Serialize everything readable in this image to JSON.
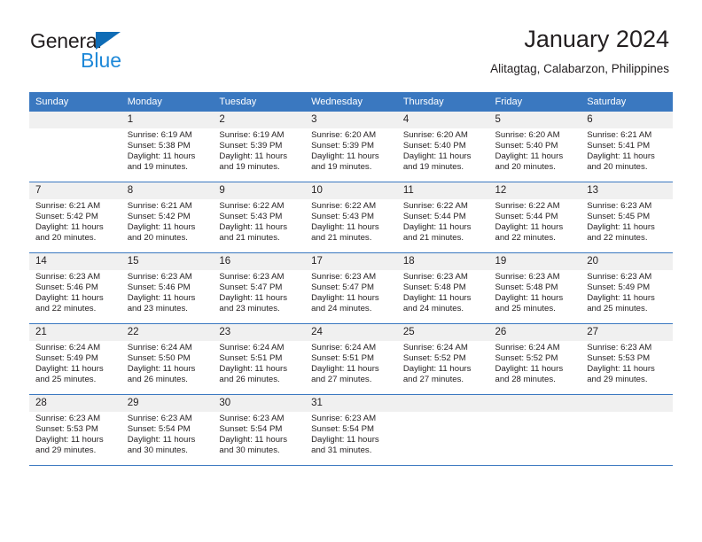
{
  "logo": {
    "word_top": "General",
    "word_bottom": "Blue",
    "triangle_color": "#0f6cb6",
    "blue_text_color": "#1e88d8"
  },
  "header": {
    "title": "January 2024",
    "subtitle": "Alitagtag, Calabarzon, Philippines"
  },
  "theme": {
    "header_blue": "#3a78c0",
    "daynum_bg": "#f0f0f0",
    "text": "#231f20"
  },
  "weekday_headers": [
    "Sunday",
    "Monday",
    "Tuesday",
    "Wednesday",
    "Thursday",
    "Friday",
    "Saturday"
  ],
  "weeks": [
    [
      {
        "day": "",
        "sunrise": "",
        "sunset": "",
        "daylight": ""
      },
      {
        "day": "1",
        "sunrise": "Sunrise: 6:19 AM",
        "sunset": "Sunset: 5:38 PM",
        "daylight": "Daylight: 11 hours and 19 minutes."
      },
      {
        "day": "2",
        "sunrise": "Sunrise: 6:19 AM",
        "sunset": "Sunset: 5:39 PM",
        "daylight": "Daylight: 11 hours and 19 minutes."
      },
      {
        "day": "3",
        "sunrise": "Sunrise: 6:20 AM",
        "sunset": "Sunset: 5:39 PM",
        "daylight": "Daylight: 11 hours and 19 minutes."
      },
      {
        "day": "4",
        "sunrise": "Sunrise: 6:20 AM",
        "sunset": "Sunset: 5:40 PM",
        "daylight": "Daylight: 11 hours and 19 minutes."
      },
      {
        "day": "5",
        "sunrise": "Sunrise: 6:20 AM",
        "sunset": "Sunset: 5:40 PM",
        "daylight": "Daylight: 11 hours and 20 minutes."
      },
      {
        "day": "6",
        "sunrise": "Sunrise: 6:21 AM",
        "sunset": "Sunset: 5:41 PM",
        "daylight": "Daylight: 11 hours and 20 minutes."
      }
    ],
    [
      {
        "day": "7",
        "sunrise": "Sunrise: 6:21 AM",
        "sunset": "Sunset: 5:42 PM",
        "daylight": "Daylight: 11 hours and 20 minutes."
      },
      {
        "day": "8",
        "sunrise": "Sunrise: 6:21 AM",
        "sunset": "Sunset: 5:42 PM",
        "daylight": "Daylight: 11 hours and 20 minutes."
      },
      {
        "day": "9",
        "sunrise": "Sunrise: 6:22 AM",
        "sunset": "Sunset: 5:43 PM",
        "daylight": "Daylight: 11 hours and 21 minutes."
      },
      {
        "day": "10",
        "sunrise": "Sunrise: 6:22 AM",
        "sunset": "Sunset: 5:43 PM",
        "daylight": "Daylight: 11 hours and 21 minutes."
      },
      {
        "day": "11",
        "sunrise": "Sunrise: 6:22 AM",
        "sunset": "Sunset: 5:44 PM",
        "daylight": "Daylight: 11 hours and 21 minutes."
      },
      {
        "day": "12",
        "sunrise": "Sunrise: 6:22 AM",
        "sunset": "Sunset: 5:44 PM",
        "daylight": "Daylight: 11 hours and 22 minutes."
      },
      {
        "day": "13",
        "sunrise": "Sunrise: 6:23 AM",
        "sunset": "Sunset: 5:45 PM",
        "daylight": "Daylight: 11 hours and 22 minutes."
      }
    ],
    [
      {
        "day": "14",
        "sunrise": "Sunrise: 6:23 AM",
        "sunset": "Sunset: 5:46 PM",
        "daylight": "Daylight: 11 hours and 22 minutes."
      },
      {
        "day": "15",
        "sunrise": "Sunrise: 6:23 AM",
        "sunset": "Sunset: 5:46 PM",
        "daylight": "Daylight: 11 hours and 23 minutes."
      },
      {
        "day": "16",
        "sunrise": "Sunrise: 6:23 AM",
        "sunset": "Sunset: 5:47 PM",
        "daylight": "Daylight: 11 hours and 23 minutes."
      },
      {
        "day": "17",
        "sunrise": "Sunrise: 6:23 AM",
        "sunset": "Sunset: 5:47 PM",
        "daylight": "Daylight: 11 hours and 24 minutes."
      },
      {
        "day": "18",
        "sunrise": "Sunrise: 6:23 AM",
        "sunset": "Sunset: 5:48 PM",
        "daylight": "Daylight: 11 hours and 24 minutes."
      },
      {
        "day": "19",
        "sunrise": "Sunrise: 6:23 AM",
        "sunset": "Sunset: 5:48 PM",
        "daylight": "Daylight: 11 hours and 25 minutes."
      },
      {
        "day": "20",
        "sunrise": "Sunrise: 6:23 AM",
        "sunset": "Sunset: 5:49 PM",
        "daylight": "Daylight: 11 hours and 25 minutes."
      }
    ],
    [
      {
        "day": "21",
        "sunrise": "Sunrise: 6:24 AM",
        "sunset": "Sunset: 5:49 PM",
        "daylight": "Daylight: 11 hours and 25 minutes."
      },
      {
        "day": "22",
        "sunrise": "Sunrise: 6:24 AM",
        "sunset": "Sunset: 5:50 PM",
        "daylight": "Daylight: 11 hours and 26 minutes."
      },
      {
        "day": "23",
        "sunrise": "Sunrise: 6:24 AM",
        "sunset": "Sunset: 5:51 PM",
        "daylight": "Daylight: 11 hours and 26 minutes."
      },
      {
        "day": "24",
        "sunrise": "Sunrise: 6:24 AM",
        "sunset": "Sunset: 5:51 PM",
        "daylight": "Daylight: 11 hours and 27 minutes."
      },
      {
        "day": "25",
        "sunrise": "Sunrise: 6:24 AM",
        "sunset": "Sunset: 5:52 PM",
        "daylight": "Daylight: 11 hours and 27 minutes."
      },
      {
        "day": "26",
        "sunrise": "Sunrise: 6:24 AM",
        "sunset": "Sunset: 5:52 PM",
        "daylight": "Daylight: 11 hours and 28 minutes."
      },
      {
        "day": "27",
        "sunrise": "Sunrise: 6:23 AM",
        "sunset": "Sunset: 5:53 PM",
        "daylight": "Daylight: 11 hours and 29 minutes."
      }
    ],
    [
      {
        "day": "28",
        "sunrise": "Sunrise: 6:23 AM",
        "sunset": "Sunset: 5:53 PM",
        "daylight": "Daylight: 11 hours and 29 minutes."
      },
      {
        "day": "29",
        "sunrise": "Sunrise: 6:23 AM",
        "sunset": "Sunset: 5:54 PM",
        "daylight": "Daylight: 11 hours and 30 minutes."
      },
      {
        "day": "30",
        "sunrise": "Sunrise: 6:23 AM",
        "sunset": "Sunset: 5:54 PM",
        "daylight": "Daylight: 11 hours and 30 minutes."
      },
      {
        "day": "31",
        "sunrise": "Sunrise: 6:23 AM",
        "sunset": "Sunset: 5:54 PM",
        "daylight": "Daylight: 11 hours and 31 minutes."
      },
      {
        "day": "",
        "sunrise": "",
        "sunset": "",
        "daylight": ""
      },
      {
        "day": "",
        "sunrise": "",
        "sunset": "",
        "daylight": ""
      },
      {
        "day": "",
        "sunrise": "",
        "sunset": "",
        "daylight": ""
      }
    ]
  ]
}
